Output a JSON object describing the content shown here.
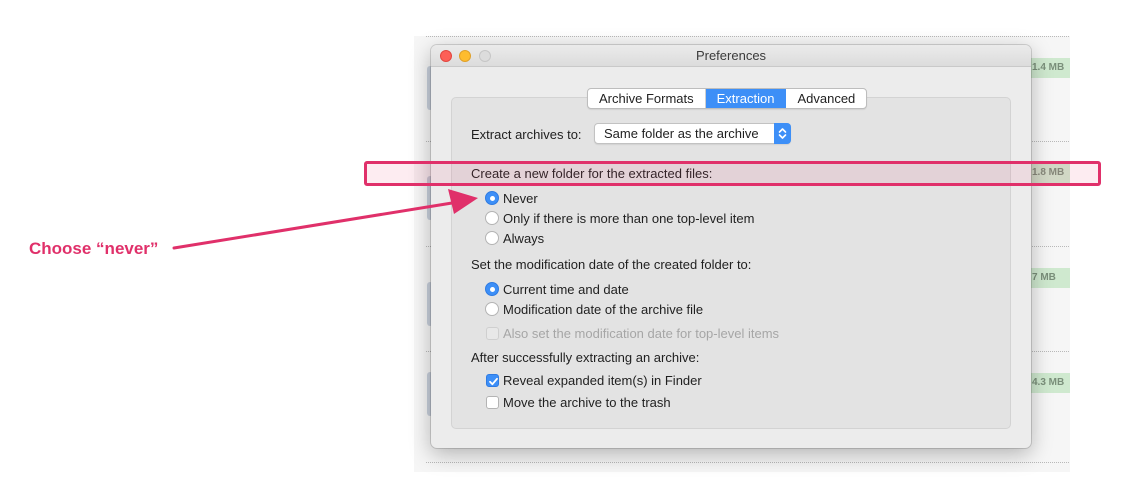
{
  "background": {
    "file_sizes": [
      "1.4 MB",
      "1.8 MB",
      "7 MB",
      "4.3 MB"
    ]
  },
  "window": {
    "title": "Preferences",
    "controls": {
      "close": "close-icon",
      "minimize": "minimize-icon",
      "zoom": "zoom-icon"
    }
  },
  "tabs": [
    {
      "label": "Archive Formats",
      "active": false
    },
    {
      "label": "Extraction",
      "active": true
    },
    {
      "label": "Advanced",
      "active": false
    }
  ],
  "extract_to": {
    "label": "Extract archives to:",
    "value": "Same folder as the archive"
  },
  "new_folder": {
    "label": "Create a new folder for the extracted files:",
    "options": [
      {
        "label": "Never",
        "selected": true
      },
      {
        "label": "Only if there is more than one top-level item",
        "selected": false
      },
      {
        "label": "Always",
        "selected": false
      }
    ]
  },
  "mod_date": {
    "label": "Set the modification date of the created folder to:",
    "options": [
      {
        "label": "Current time and date",
        "selected": true
      },
      {
        "label": "Modification date of the archive file",
        "selected": false
      }
    ],
    "top_level_checkbox": {
      "label": "Also set the modification date for top-level items",
      "checked": false,
      "enabled": false
    }
  },
  "after_extract": {
    "label": "After successfully extracting an archive:",
    "checkboxes": [
      {
        "label": "Reveal expanded item(s) in Finder",
        "checked": true
      },
      {
        "label": "Move the archive to the trash",
        "checked": false
      }
    ]
  },
  "annotation": {
    "callout": "Choose “never”",
    "color": "#e0306a"
  },
  "colors": {
    "accent": "#3d8ff7",
    "annotation": "#e0306a"
  }
}
